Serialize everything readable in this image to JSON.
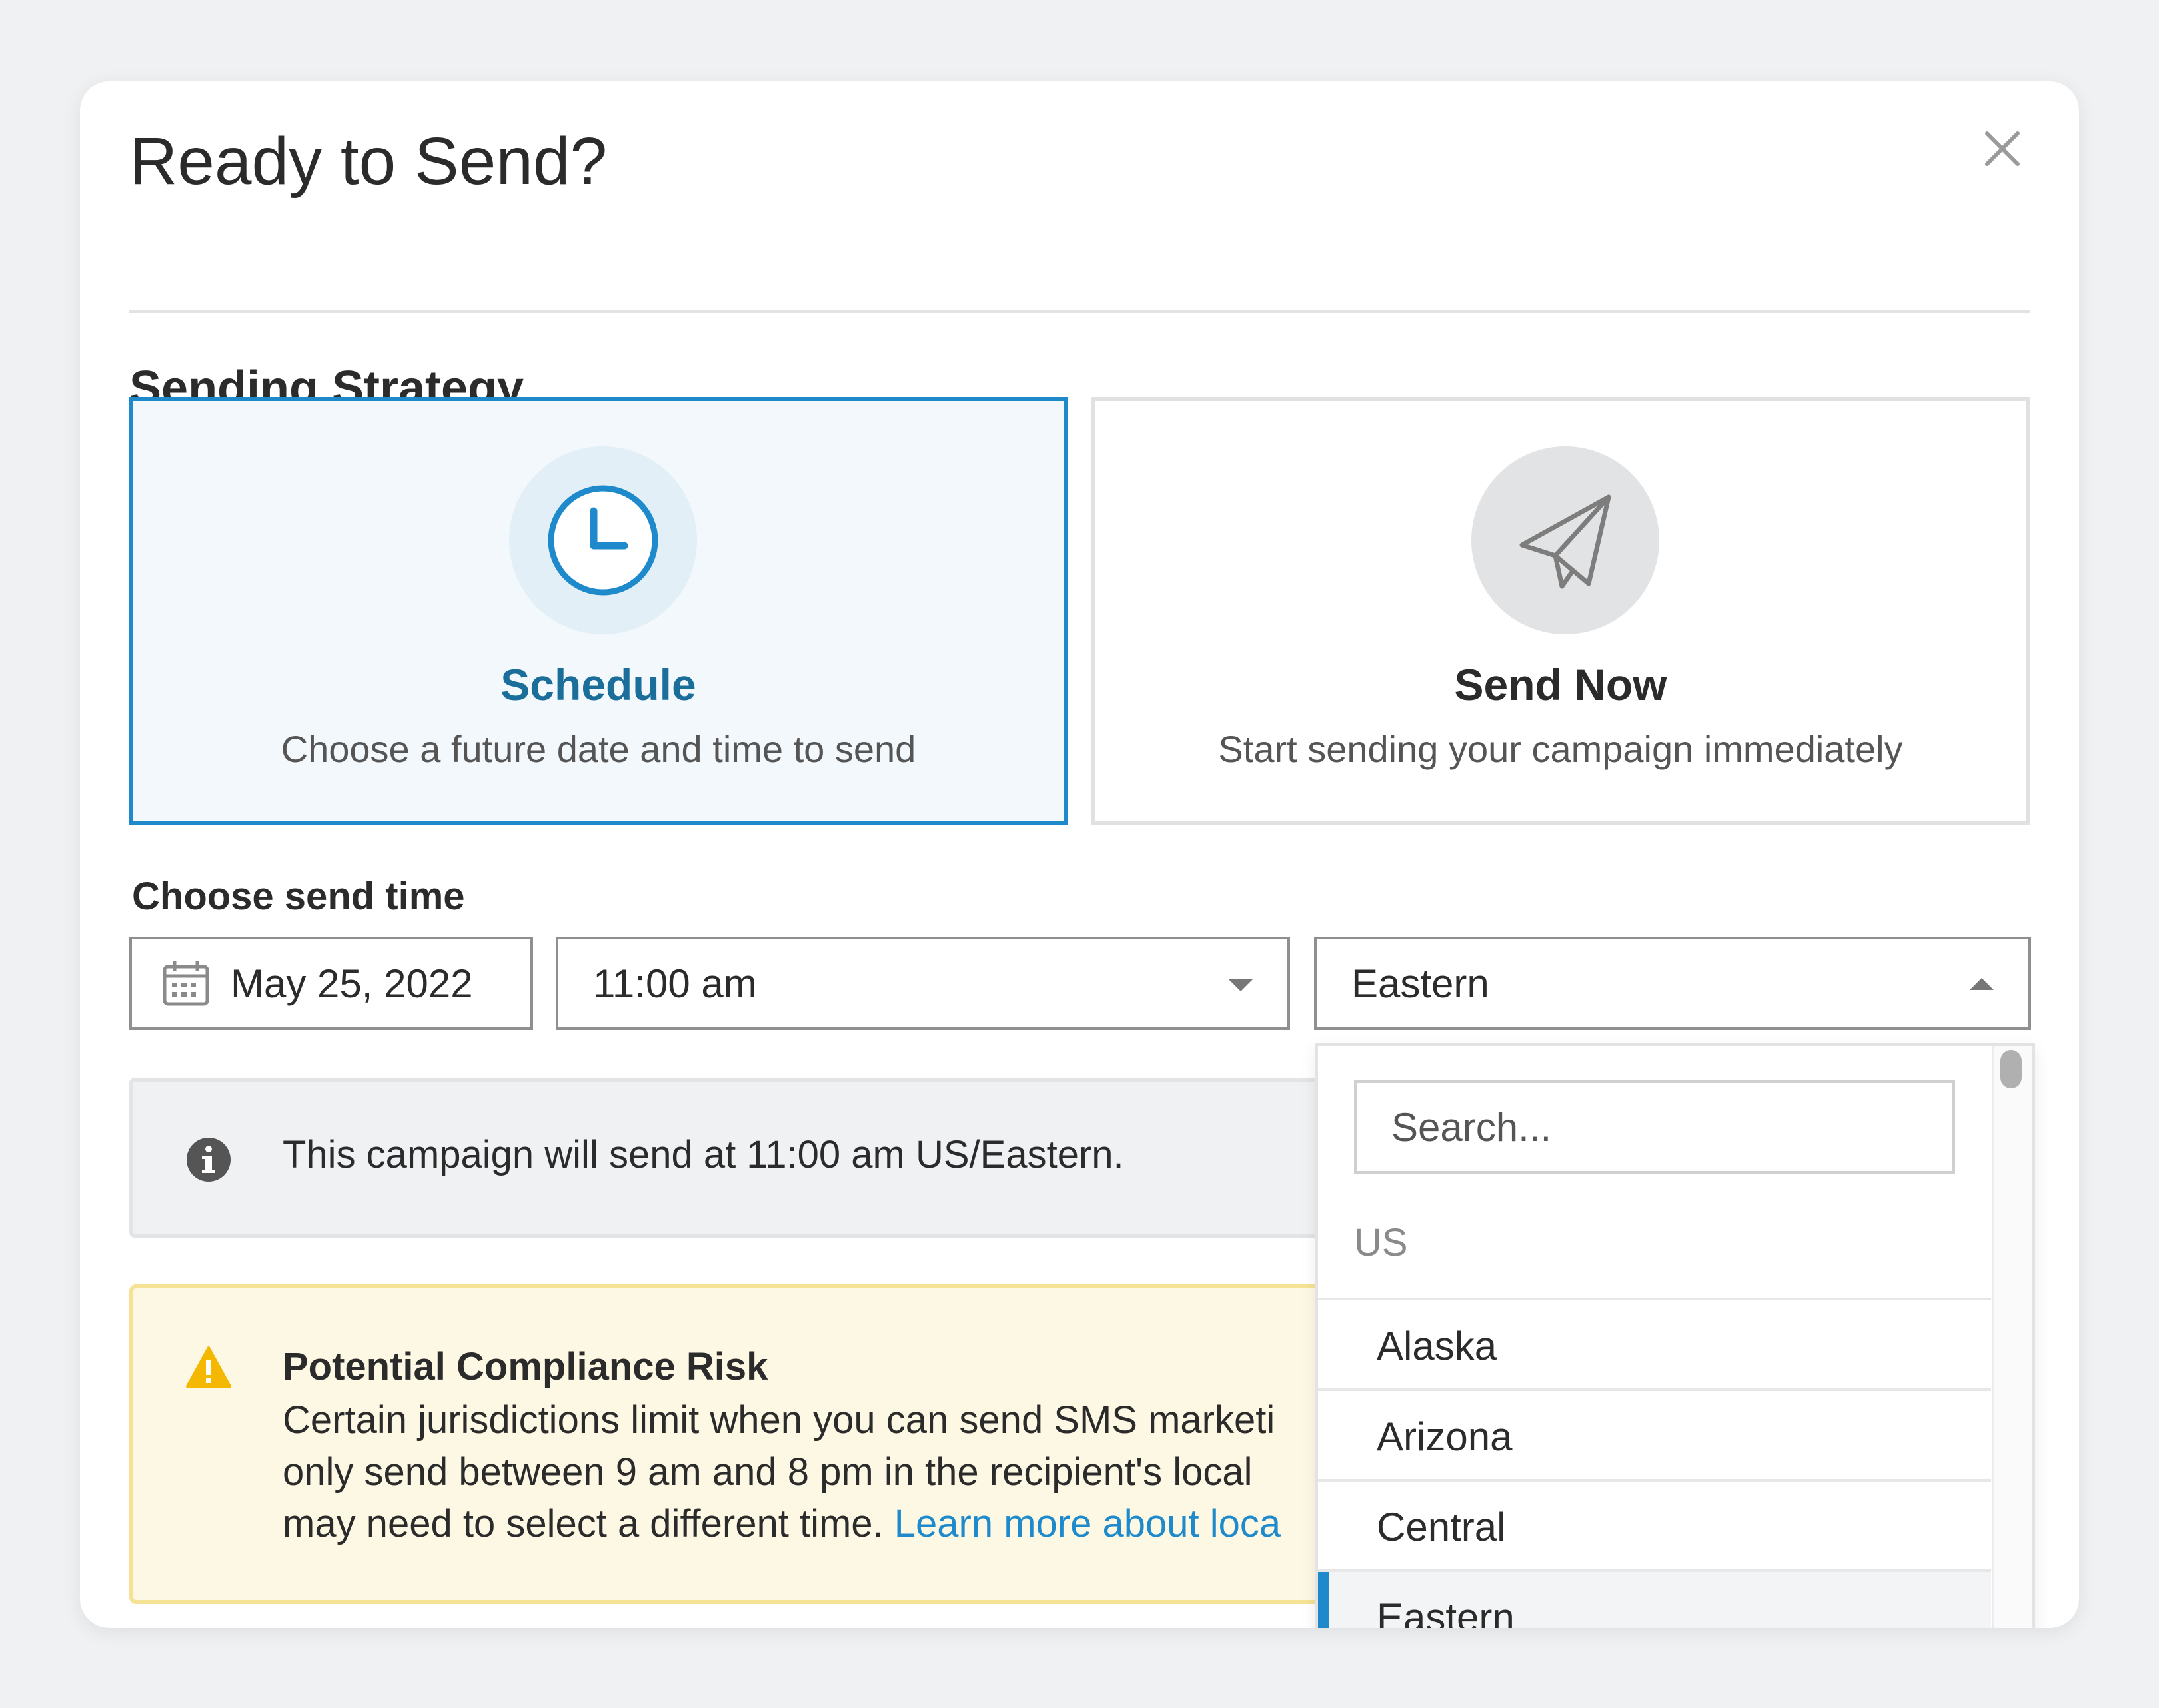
{
  "modal": {
    "title": "Ready to Send?"
  },
  "strategy": {
    "heading": "Sending Strategy",
    "options": [
      {
        "title": "Schedule",
        "description": "Choose a future date and time to send",
        "icon": "clock-icon",
        "selected": true
      },
      {
        "title": "Send Now",
        "description": "Start sending your campaign immediately",
        "icon": "paper-plane-icon",
        "selected": false
      }
    ]
  },
  "send_time": {
    "label": "Choose send time",
    "date": "May 25, 2022",
    "time": "11:00 am",
    "timezone": "Eastern"
  },
  "info": {
    "text": "This campaign will send at 11:00 am US/Eastern."
  },
  "warning": {
    "title": "Potential Compliance Risk",
    "line1": "Certain jurisdictions limit when you can send SMS marketi",
    "line2": "only send between 9 am and 8 pm in the recipient's local",
    "line3_prefix": "may need to select a different time.",
    "line3_link": "Learn more about loca"
  },
  "timezone_dropdown": {
    "search_placeholder": "Search...",
    "group_label": "US",
    "options": [
      "Alaska",
      "Arizona",
      "Central",
      "Eastern"
    ],
    "selected": "Eastern"
  },
  "colors": {
    "accent": "#1f8acb",
    "warning_bg": "#fdf8e3",
    "warning_icon": "#f5b800"
  }
}
